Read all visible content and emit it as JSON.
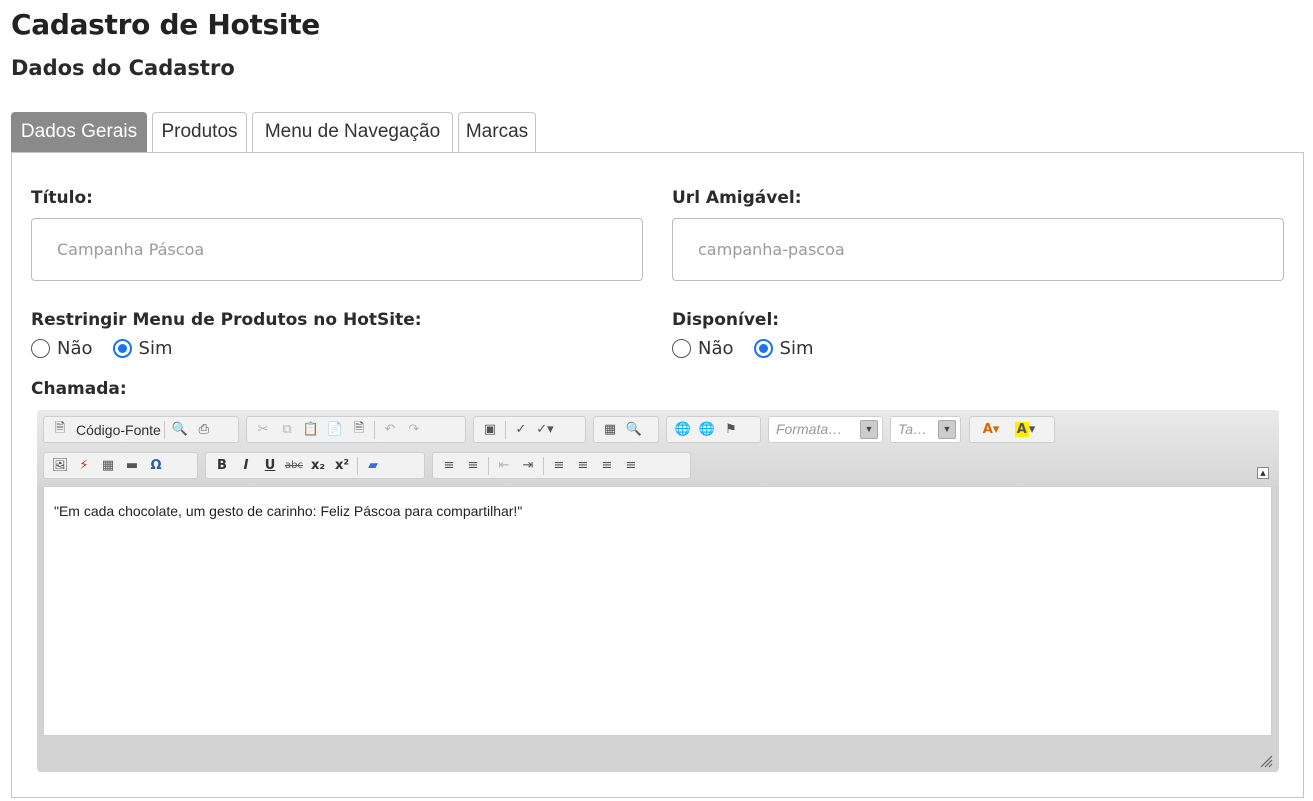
{
  "header": {
    "title": "Cadastro de Hotsite",
    "subtitle": "Dados do Cadastro"
  },
  "tabs": [
    {
      "label": "Dados Gerais",
      "active": true
    },
    {
      "label": "Produtos",
      "active": false
    },
    {
      "label": "Menu de Navegação",
      "active": false
    },
    {
      "label": "Marcas",
      "active": false
    }
  ],
  "form": {
    "titulo": {
      "label": "Título:",
      "value": "Campanha Páscoa"
    },
    "url": {
      "label": "Url Amigável:",
      "value": "campanha-pascoa"
    },
    "restringir": {
      "label": "Restringir Menu de Produtos no HotSite:",
      "options": [
        "Não",
        "Sim"
      ],
      "selected": "Sim"
    },
    "disponivel": {
      "label": "Disponível:",
      "options": [
        "Não",
        "Sim"
      ],
      "selected": "Sim"
    },
    "chamada": {
      "label": "Chamada:"
    }
  },
  "editor": {
    "source_label": "Código-Fonte",
    "format_placeholder": "Formata…",
    "size_placeholder": "Ta…",
    "content": "\"Em cada chocolate, um gesto de carinho: Feliz Páscoa para compartilhar!\""
  },
  "colors": {
    "accent": "#1a73e8",
    "active_tab": "#8a8a8a"
  }
}
